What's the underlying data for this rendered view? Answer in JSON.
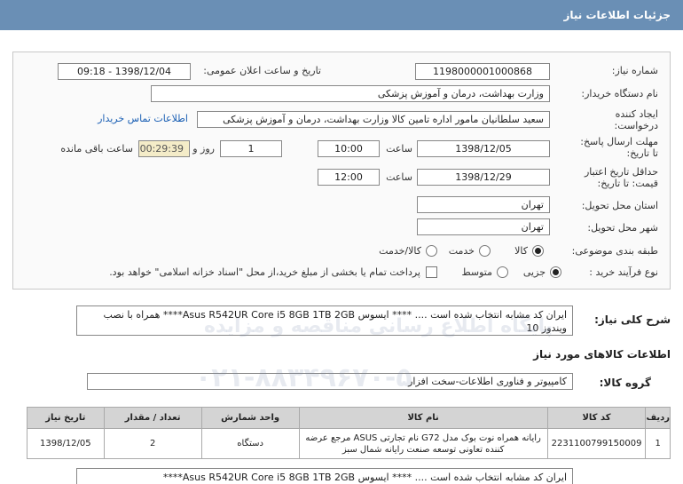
{
  "header": {
    "title": "جزئیات اطلاعات نیاز"
  },
  "fields": {
    "need_number_label": "شماره نیاز:",
    "need_number": "1198000001000868",
    "announce_label": "تاریخ و ساعت اعلان عمومی:",
    "announce_value": "1398/12/04 - 09:18",
    "buyer_org_label": "نام دستگاه خریدار:",
    "buyer_org": "وزارت بهداشت، درمان و آموزش پزشکی",
    "creator_label": "ایجاد کننده درخواست:",
    "creator": "سعید سلطانیان مامور اداره تامین کالا وزارت بهداشت، درمان و آموزش پزشکی",
    "contact_link": "اطلاعات تماس خریدار",
    "reply_deadline_label": "مهلت ارسال پاسخ: تا تاریخ:",
    "reply_date": "1398/12/05",
    "time_label": "ساعت",
    "reply_time": "10:00",
    "days_count": "1",
    "days_label": "روز و",
    "remaining_timer": "00:29:39",
    "remaining_label": "ساعت باقی مانده",
    "validity_label": "حداقل تاریخ اعتبار قیمت: تا تاریخ:",
    "validity_date": "1398/12/29",
    "validity_time": "12:00",
    "province_label": "استان محل تحویل:",
    "province": "تهران",
    "city_label": "شهر محل تحویل:",
    "city": "تهران",
    "category_label": "طبقه بندی موضوعی:",
    "category_options": [
      "کالا",
      "خدمت",
      "کالا/خدمت"
    ],
    "process_label": "نوع فرآیند خرید :",
    "process_options": [
      "جزیی",
      "متوسط"
    ],
    "payment_note": "پرداخت تمام یا بخشی از مبلغ خرید،از محل \"اسناد خزانه اسلامی\" خواهد بود."
  },
  "description": {
    "label": "شرح کلی نیاز:",
    "text": "ایران کد مشابه انتخاب شده است .... **** ایسوس Asus R542UR Core i5 8GB 1TB 2GB**** همراه با نصب ویندوز 10"
  },
  "goods_info": {
    "label": "اطلاعات کالاهای مورد نیاز"
  },
  "goods_group": {
    "label": "گروه کالا:",
    "value": "کامپیوتر و فناوری اطلاعات-سخت افزار"
  },
  "table": {
    "headers": [
      "ردیف",
      "کد کالا",
      "نام کالا",
      "واحد شمارش",
      "تعداد / مقدار",
      "تاریخ نیاز"
    ],
    "rows": [
      {
        "index": "1",
        "code": "2231100799150009",
        "name": "رایانه همراه نوت بوک مدل G72 نام تجارتی ASUS مرجع عرضه کننده تعاونی توسعه صنعت رایانه شمال سبز",
        "unit": "دستگاه",
        "qty": "2",
        "date": "1398/12/05"
      }
    ]
  },
  "bottom_note": "ایران کد مشابه انتخاب شده است .... **** ایسوس Asus R542UR Core i5 8GB 1TB 2GB****",
  "watermark": {
    "line1": "پایگاه اطلاع رسانی مناقصه و مزایده",
    "line2": "۰۲۱-۸۸۳۴۹۶۷۰-۵"
  }
}
